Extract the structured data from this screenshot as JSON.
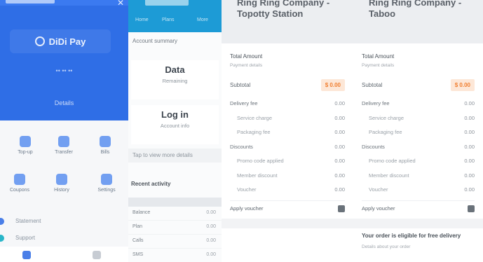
{
  "panel1": {
    "brand": "DiDi Pay",
    "sub": "•• •• ••",
    "link": "Details",
    "grid": [
      {
        "label": "Top-up"
      },
      {
        "label": "Transfer"
      },
      {
        "label": "Bills"
      },
      {
        "label": "Coupons"
      },
      {
        "label": "History"
      },
      {
        "label": "Settings"
      }
    ],
    "list": [
      "Statement",
      "Support"
    ]
  },
  "panel2": {
    "section_title": "Account summary",
    "card1": {
      "big": "Data",
      "small": "Remaining"
    },
    "card2": {
      "big": "Log in",
      "small": "Account info"
    },
    "bar_text": "Tap to view more details",
    "subhead": "Recent activity",
    "tabs": [
      "Home",
      "Plans",
      "More"
    ],
    "rows": [
      {
        "k": "Balance",
        "v": "0.00"
      },
      {
        "k": "Plan",
        "v": "0.00"
      },
      {
        "k": "Calls",
        "v": "0.00"
      },
      {
        "k": "SMS",
        "v": "0.00"
      }
    ]
  },
  "panel3": {
    "title": "Ring Ring Company - Topotty Station",
    "card_title": "Total Amount",
    "card_sub": "Payment details",
    "amount_label": "Subtotal",
    "amount_value": "$ 0.00",
    "lines": [
      {
        "k": "Delivery fee",
        "v": "0.00",
        "sub": false
      },
      {
        "k": "Service charge",
        "v": "0.00",
        "sub": true
      },
      {
        "k": "Packaging fee",
        "v": "0.00",
        "sub": true
      },
      {
        "k": "Discounts",
        "v": "0.00",
        "sub": false
      },
      {
        "k": "Promo code applied",
        "v": "0.00",
        "sub": true
      },
      {
        "k": "Member discount",
        "v": "0.00",
        "sub": true
      },
      {
        "k": "Voucher",
        "v": "0.00",
        "sub": true
      }
    ],
    "total_label": "Apply voucher"
  },
  "panel4": {
    "title": "Ring Ring Company - Taboo",
    "card_title": "Total Amount",
    "card_sub": "Payment details",
    "amount_label": "Subtotal",
    "amount_value": "$ 0.00",
    "lines": [
      {
        "k": "Delivery fee",
        "v": "0.00",
        "sub": false
      },
      {
        "k": "Service charge",
        "v": "0.00",
        "sub": true
      },
      {
        "k": "Packaging fee",
        "v": "0.00",
        "sub": true
      },
      {
        "k": "Discounts",
        "v": "0.00",
        "sub": false
      },
      {
        "k": "Promo code applied",
        "v": "0.00",
        "sub": true
      },
      {
        "k": "Member discount",
        "v": "0.00",
        "sub": true
      },
      {
        "k": "Voucher",
        "v": "0.00",
        "sub": true
      }
    ],
    "total_label": "Apply voucher",
    "foot_title": "Your order is eligible for free delivery",
    "foot_sub": "Details about your order"
  }
}
